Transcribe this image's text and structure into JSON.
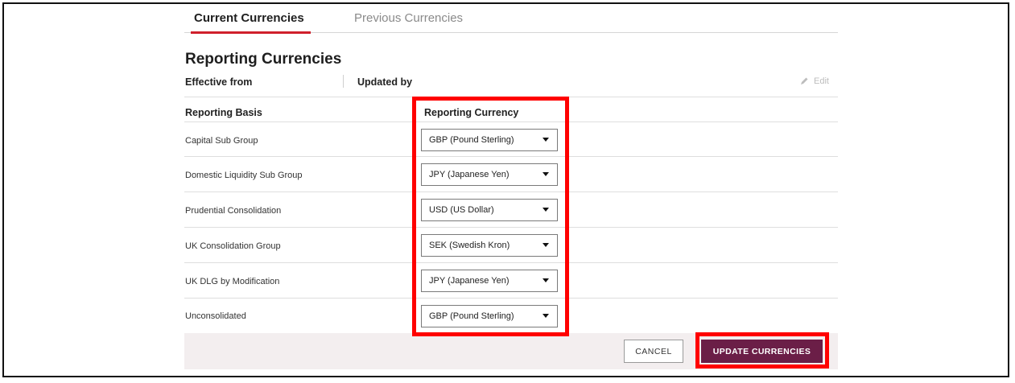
{
  "tabs": [
    {
      "label": "Current Currencies",
      "active": true
    },
    {
      "label": "Previous Currencies",
      "active": false
    }
  ],
  "section": {
    "title": "Reporting Currencies",
    "effective_from_label": "Effective from",
    "updated_by_label": "Updated by",
    "edit_label": "Edit"
  },
  "table": {
    "headers": [
      "Reporting Basis",
      "Reporting Currency"
    ],
    "rows": [
      {
        "basis": "Capital Sub Group",
        "currency": "GBP (Pound Sterling)"
      },
      {
        "basis": "Domestic Liquidity Sub Group",
        "currency": "JPY (Japanese Yen)"
      },
      {
        "basis": "Prudential Consolidation",
        "currency": "USD (US Dollar)"
      },
      {
        "basis": "UK Consolidation Group",
        "currency": "SEK (Swedish Kron)"
      },
      {
        "basis": "UK DLG by Modification",
        "currency": "JPY (Japanese Yen)"
      },
      {
        "basis": "Unconsolidated",
        "currency": "GBP (Pound Sterling)"
      }
    ]
  },
  "actions": {
    "cancel_label": "CANCEL",
    "update_label": "UPDATE CURRENCIES"
  },
  "colors": {
    "accent_tab": "#d0202c",
    "primary_button": "#6b1e47",
    "highlight": "#ff0000",
    "footer_bg": "#f3eeef"
  },
  "icons": {
    "edit": "pencil-icon",
    "dropdown": "caret-down-icon"
  }
}
